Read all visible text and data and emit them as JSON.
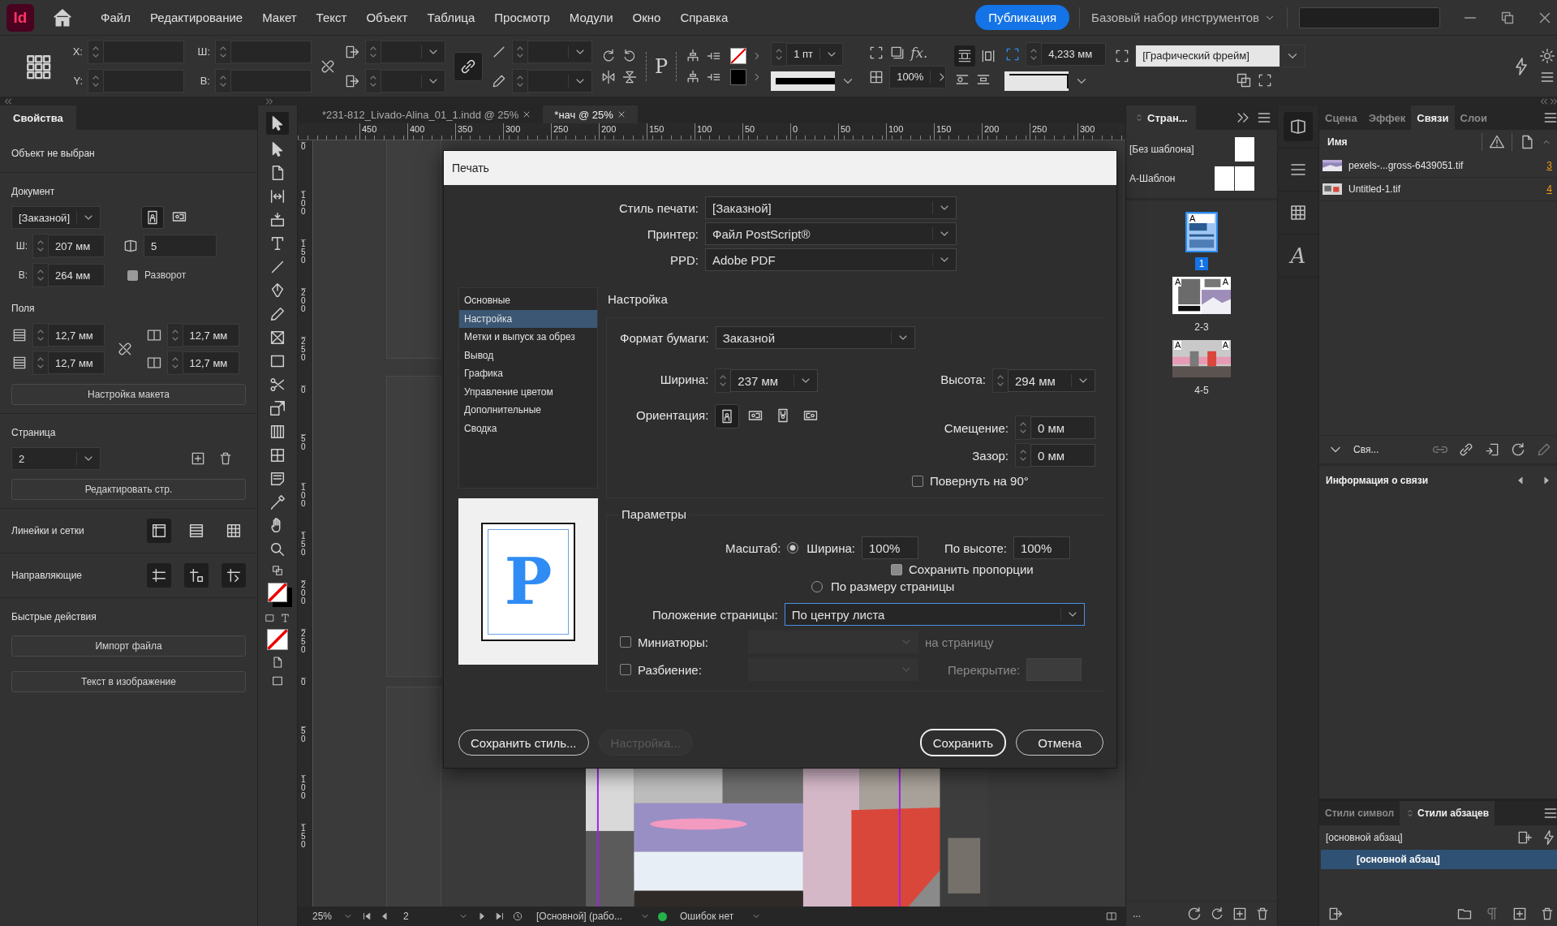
{
  "app": {
    "logo": "Id"
  },
  "menu": [
    "Файл",
    "Редактирование",
    "Макет",
    "Текст",
    "Объект",
    "Таблица",
    "Просмотр",
    "Модули",
    "Окно",
    "Справка"
  ],
  "publish_button": "Публикация",
  "workspace": "Базовый набор инструментов",
  "control_bar": {
    "x_label": "X:",
    "y_label": "Y:",
    "w_label": "Ш:",
    "h_label": "В:",
    "frame_glyph": "P",
    "stroke_weight": "1 пт",
    "effects": "fx.",
    "opacity": "100%",
    "wrap_offset": "4,233 мм",
    "object_style": "[Графический фрейм]"
  },
  "doc_tabs": [
    {
      "label": "*231-812_Livado-Alina_01_1.indd @ 25%",
      "selected": false
    },
    {
      "label": "*нач @ 25%",
      "selected": true
    }
  ],
  "h_ruler": [
    "450",
    "400",
    "350",
    "300",
    "250",
    "200",
    "150",
    "100",
    "50",
    "0",
    "50",
    "100",
    "150",
    "200",
    "250",
    "300"
  ],
  "v_ruler": [
    "0",
    "100",
    "150",
    "200",
    "250",
    "0",
    "50",
    "100",
    "150",
    "200",
    "250",
    "0",
    "50",
    "100",
    "150"
  ],
  "properties": {
    "tab": "Свойства",
    "status": "Объект не выбран",
    "document": {
      "title": "Документ",
      "preset": "[Заказной]",
      "orientations": [
        {
          "kind": "portrait",
          "selected": true
        },
        {
          "kind": "landscape",
          "selected": false
        }
      ],
      "w_label": "Ш:",
      "width": "207 мм",
      "h_label": "В:",
      "height": "264 мм",
      "pages": "5",
      "facing": {
        "label": "Разворот",
        "checked": true
      }
    },
    "margins": {
      "title": "Поля",
      "top": "12,7 мм",
      "bottom": "12,7 мм",
      "inside": "12,7 мм",
      "outside": "12,7 мм"
    },
    "layout_button": "Настройка макета",
    "page": {
      "title": "Страница",
      "value": "2",
      "edit_button": "Редактировать стр."
    },
    "rulers_title": "Линейки и сетки",
    "guides_title": "Направляющие",
    "quick_actions": {
      "title": "Быстрые действия",
      "buttons": [
        "Импорт файла",
        "Текст в изображение"
      ]
    }
  },
  "print_dialog": {
    "title": "Печать",
    "top_fields": [
      {
        "label": "Стиль печати:",
        "value": "[Заказной]"
      },
      {
        "label": "Принтер:",
        "value": "Файл PostScript®"
      },
      {
        "label": "PPD:",
        "value": "Adobe PDF"
      }
    ],
    "sections": [
      {
        "label": "Основные",
        "selected": false
      },
      {
        "label": "Настройка",
        "selected": true
      },
      {
        "label": "Метки и выпуск за обрез",
        "selected": false
      },
      {
        "label": "Вывод",
        "selected": false
      },
      {
        "label": "Графика",
        "selected": false
      },
      {
        "label": "Управление цветом",
        "selected": false
      },
      {
        "label": "Дополнительные",
        "selected": false
      },
      {
        "label": "Сводка",
        "selected": false
      }
    ],
    "preview_glyph": "P",
    "setup": {
      "title": "Настройка",
      "paper_label": "Формат бумаги:",
      "paper": "Заказной",
      "width_label": "Ширина:",
      "width": "237 мм",
      "height_label": "Высота:",
      "height": "294 мм",
      "orientation_label": "Ориентация:",
      "orientations": [
        {
          "selected": true
        },
        {
          "selected": false
        },
        {
          "selected": false
        },
        {
          "selected": false
        }
      ],
      "offset_label": "Смещение:",
      "offset": "0 мм",
      "gap_label": "Зазор:",
      "gap": "0 мм",
      "rotate": {
        "label": "Повернуть на 90°",
        "checked": false
      }
    },
    "options": {
      "title": "Параметры",
      "scale_label": "Масштаб:",
      "scale_width": {
        "label": "Ширина:",
        "selected": true
      },
      "width_value": "100%",
      "height_label": "По высоте:",
      "height_value": "100%",
      "proportions": {
        "label": "Сохранить пропорции",
        "checked": true
      },
      "fit": {
        "label": "По размеру страницы",
        "selected": false
      },
      "position_label": "Положение страницы:",
      "position": "По центру листа",
      "thumbnails": {
        "label": "Миниатюры:",
        "checked": false
      },
      "per_page": "на страницу",
      "tiling": {
        "label": "Разбиение:",
        "checked": false
      },
      "overlap_label": "Перекрытие:"
    },
    "buttons": [
      {
        "label": "Сохранить стиль...",
        "kind": "normal"
      },
      {
        "label": "Настройка...",
        "kind": "disabled"
      },
      {
        "label": "Сохранить",
        "kind": "default"
      },
      {
        "label": "Отмена",
        "kind": "normal"
      }
    ]
  },
  "pages_panel": {
    "title": "Стран...",
    "masters": [
      {
        "label": "[Без шаблона]",
        "spread": false
      },
      {
        "label": "А-Шаблон",
        "spread": true
      }
    ],
    "pages": [
      {
        "label": "1",
        "selected": true,
        "kind": "single",
        "marks": [
          "A"
        ]
      },
      {
        "label": "2-3",
        "selected": false,
        "kind": "spread",
        "marks": [
          "A",
          "A"
        ]
      },
      {
        "label": "4-5",
        "selected": false,
        "kind": "collage",
        "marks": [
          "A",
          "A"
        ]
      }
    ],
    "more": "..."
  },
  "icon_strip": {
    "glyph": "A"
  },
  "links_panel": {
    "tabs": [
      {
        "label": "Сцена",
        "selected": false
      },
      {
        "label": "Эффек",
        "selected": false
      },
      {
        "label": "Связи",
        "selected": true
      },
      {
        "label": "Слои",
        "selected": false
      }
    ],
    "name_header": "Имя",
    "links": [
      {
        "name": "pexels-...gross-6439051.tif",
        "page": "3"
      },
      {
        "name": "Untitled-1.tif",
        "page": "4"
      }
    ],
    "info_toggle": "Свя...",
    "info_title": "Информация о связи"
  },
  "styles_panel": {
    "tabs": [
      {
        "label": "Стили символ",
        "selected": false
      },
      {
        "label": "Стили абзацев",
        "selected": true
      }
    ],
    "current": "[основной абзац]",
    "styles": [
      {
        "label": "[основной абзац]",
        "selected": true
      }
    ]
  },
  "status_bar": {
    "zoom": "25%",
    "page": "2",
    "profile": "[Основной] (рабо...",
    "preflight": "Ошибок нет"
  }
}
